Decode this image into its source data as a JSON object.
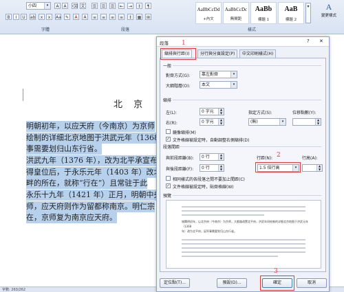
{
  "ribbon": {
    "font_size": "小四",
    "group_font": "字體",
    "group_paragraph": "段落",
    "group_styles": "樣式",
    "styles": [
      {
        "preview": "AaBbCcDd",
        "name": "+內文"
      },
      {
        "preview": "AaBbCcDc",
        "name": "無間距"
      },
      {
        "preview": "AaBb",
        "name": "標題 1"
      },
      {
        "preview": "AaB",
        "name": "標題 2"
      }
    ],
    "change_styles": "變更樣式"
  },
  "document": {
    "title": "北 京",
    "lines": [
      "明朝初年，以应天府（今南京）为京师",
      "绘制的详细北京地图于洪武元年（1368",
      "事需要划归山东行省。",
      "洪武九年（1376 年），改为北平承宣布",
      "得皇位后，于永乐元年（1403 年）改北",
      "畔的所在，就称“行在”）且常驻于此",
      "永乐十九年（1421 年）正月，明朝中央",
      "师，应天府则作为留都称南京。明仁宗",
      "在，京师复为南京应天府。"
    ]
  },
  "status": {
    "left": "字數: 263/262"
  },
  "dialog": {
    "title": "段落",
    "help": "?",
    "close": "✕",
    "tabs": [
      "縮排與行距(I)",
      "分行與分頁設定(P)",
      "中文印刷樣式(H)"
    ],
    "general": {
      "heading": "一般",
      "alignment_label": "對齊方式(G):",
      "alignment_value": "靠左對齊",
      "outline_label": "大綱階層(O):",
      "outline_value": "本文"
    },
    "indent": {
      "heading": "縮排",
      "left_label": "左(L):",
      "left_value": "0 字元",
      "right_label": "右(R):",
      "right_value": "0 字元",
      "special_label": "指定方式(S):",
      "special_value": "(無)",
      "by_label": "位移點數(Y):",
      "mirror_label": "鏡像縮排(M)",
      "auto_adjust_label": "文件格線被設定時，自動調整右側縮排(D)"
    },
    "spacing": {
      "heading": "段落間距",
      "before_label": "與前段距離(B):",
      "before_value": "0 行",
      "after_label": "與後段距離(F):",
      "after_value": "0 行",
      "line_spacing_label": "行距(N):",
      "line_spacing_value": "1.5 倍行高",
      "at_label": "行高(A):",
      "no_space_label": "相同樣式的各段落之間不要加上間距(C)",
      "snap_grid_label": "文件格線被設定時，貼齊格線(W)"
    },
    "preview": {
      "heading": "預覽",
      "sample_text_1": "城關明初年，以北京府（今南京）为京师，大都路改置北平府，洪武年间绘制的详细北京地图于洪武元年（1368",
      "sample_text_2": "年）改为北平府，因军事需要划归山东行省。"
    },
    "buttons": {
      "tabs": "定位點(T)...",
      "default": "預設(D)...",
      "ok": "確定",
      "cancel": "取消"
    },
    "annotations": [
      "1",
      "2",
      "3"
    ]
  },
  "colors": {
    "annotation": "#e23b3b",
    "selection": "#b7d1ec",
    "dialog_bg": "#eef2f8"
  }
}
